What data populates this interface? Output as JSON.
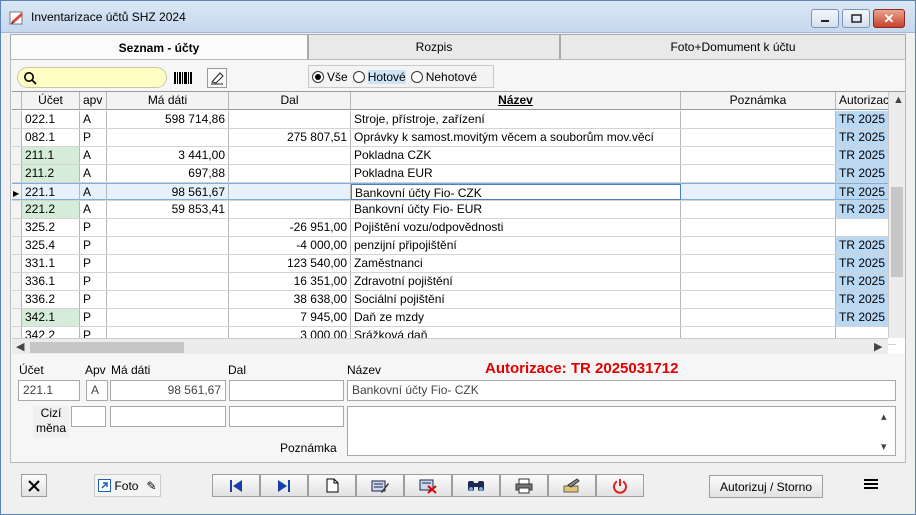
{
  "window": {
    "title": "Inventarizace účtů SHZ 2024"
  },
  "tabs": [
    {
      "label": "Seznam - účty"
    },
    {
      "label": "Rozpis"
    },
    {
      "label": "Foto+Domument k účtu"
    }
  ],
  "filter": {
    "search_value": "",
    "options": [
      {
        "label": "Vše",
        "selected": true
      },
      {
        "label": "Hotové",
        "selected": false
      },
      {
        "label": "Nehotové",
        "selected": false
      }
    ]
  },
  "grid": {
    "headers": [
      "Účet",
      "apv",
      "Má dáti",
      "Dal",
      "Název",
      "Poznámka",
      "Autorizace"
    ],
    "rows": [
      {
        "ucet": "022.1",
        "apv": "A",
        "ma": "598 714,86",
        "dal": "",
        "nazev": "Stroje, přístroje, zařízení",
        "poz": "",
        "aut": "TR  2025",
        "green": false,
        "blue": true
      },
      {
        "ucet": "082.1",
        "apv": "P",
        "ma": "",
        "dal": "275 807,51",
        "nazev": "Oprávky k samost.movitým věcem a souborům mov.věcí",
        "poz": "",
        "aut": "TR  2025",
        "green": false,
        "blue": true
      },
      {
        "ucet": "211.1",
        "apv": "A",
        "ma": "3 441,00",
        "dal": "",
        "nazev": "Pokladna CZK",
        "poz": "",
        "aut": "TR  2025",
        "green": true,
        "blue": true
      },
      {
        "ucet": "211.2",
        "apv": "A",
        "ma": "697,88",
        "dal": "",
        "nazev": "Pokladna EUR",
        "poz": "",
        "aut": "TR  2025",
        "green": true,
        "blue": true
      },
      {
        "ucet": "221.1",
        "apv": "A",
        "ma": "98 561,67",
        "dal": "",
        "nazev": "Bankovní účty Fio- CZK",
        "poz": "",
        "aut": "TR  2025",
        "green": false,
        "blue": true,
        "selected": true
      },
      {
        "ucet": "221.2",
        "apv": "A",
        "ma": "59 853,41",
        "dal": "",
        "nazev": "Bankovní účty Fio- EUR",
        "poz": "",
        "aut": "TR  2025",
        "green": true,
        "blue": true
      },
      {
        "ucet": "325.2",
        "apv": "P",
        "ma": "",
        "dal": "-26 951,00",
        "nazev": "Pojištění vozu/odpovědnosti",
        "poz": "",
        "aut": "",
        "green": false,
        "blue": false
      },
      {
        "ucet": "325.4",
        "apv": "P",
        "ma": "",
        "dal": "-4 000,00",
        "nazev": "penzijní připojištění",
        "poz": "",
        "aut": "TR  2025",
        "green": false,
        "blue": true
      },
      {
        "ucet": "331.1",
        "apv": "P",
        "ma": "",
        "dal": "123 540,00",
        "nazev": "Zaměstnanci",
        "poz": "",
        "aut": "TR  2025",
        "green": false,
        "blue": true
      },
      {
        "ucet": "336.1",
        "apv": "P",
        "ma": "",
        "dal": "16 351,00",
        "nazev": "Zdravotní pojištění",
        "poz": "",
        "aut": "TR  2025",
        "green": false,
        "blue": true
      },
      {
        "ucet": "336.2",
        "apv": "P",
        "ma": "",
        "dal": "38 638,00",
        "nazev": "Sociální pojištění",
        "poz": "",
        "aut": "TR  2025",
        "green": false,
        "blue": true
      },
      {
        "ucet": "342.1",
        "apv": "P",
        "ma": "",
        "dal": "7 945,00",
        "nazev": "Daň ze mzdy",
        "poz": "",
        "aut": "TR  2025",
        "green": true,
        "blue": true
      },
      {
        "ucet": "342.2",
        "apv": "P",
        "ma": "",
        "dal": "3 000,00",
        "nazev": "Srážková daň",
        "poz": "",
        "aut": "",
        "green": false,
        "blue": false
      }
    ]
  },
  "detail": {
    "labels": {
      "ucet": "Účet",
      "apv": "Apv",
      "ma": "Má dáti",
      "dal": "Dal",
      "nazev": "Název",
      "cizi": "Cizí měna",
      "poznamka": "Poznámka"
    },
    "ucet": "221.1",
    "apv": "A",
    "ma": "98 561,67",
    "dal": "",
    "nazev": "Bankovní účty Fio- CZK",
    "poznamka": "",
    "autorizace": "Autorizace: TR   2025031712"
  },
  "bottom": {
    "foto_label": "Foto",
    "autorizuj_label": "Autorizuj / Storno"
  }
}
